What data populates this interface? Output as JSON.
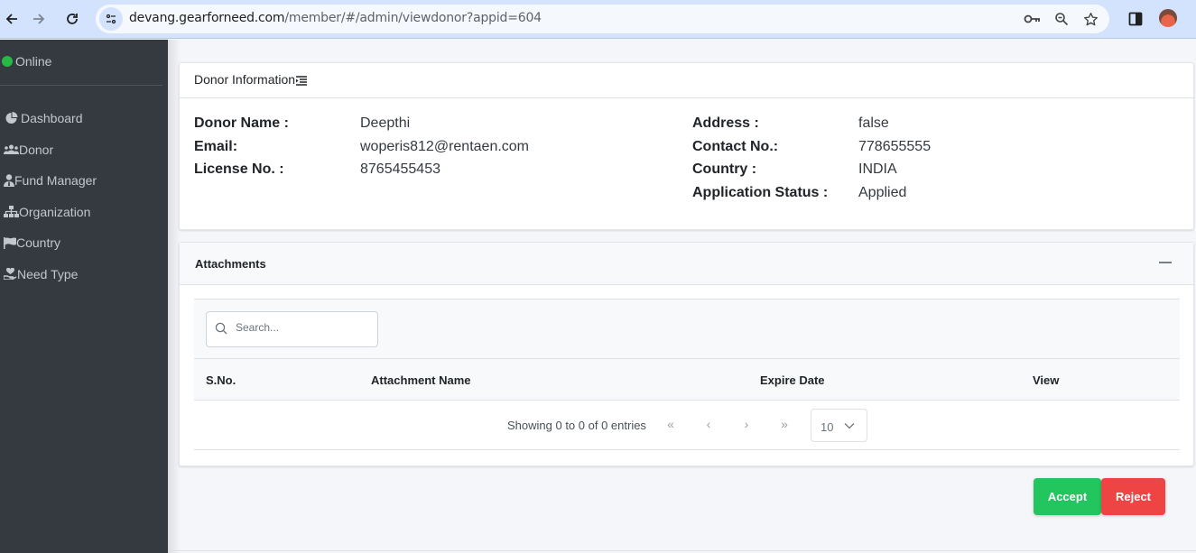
{
  "browser": {
    "url_domain": "devang.gearforneed.com",
    "url_path": "/member/#/admin/viewdonor?appid=604",
    "icons": [
      "back-icon",
      "forward-icon",
      "reload-icon",
      "site-info-icon",
      "password-key-icon",
      "zoom-icon",
      "bookmark-star-icon",
      "side-panel-icon",
      "profile-avatar"
    ]
  },
  "sidebar": {
    "status": "Online",
    "status_color": "#28b845",
    "items": [
      {
        "label": "Dashboard",
        "icon": "pie-chart-icon"
      },
      {
        "label": "Donor",
        "icon": "users-icon"
      },
      {
        "label": "Fund Manager",
        "icon": "user-tie-icon"
      },
      {
        "label": "Organization",
        "icon": "sitemap-icon"
      },
      {
        "label": "Country",
        "icon": "flag-icon"
      },
      {
        "label": "Need Type",
        "icon": "hand-heart-icon"
      }
    ]
  },
  "donor_info": {
    "title": "Donor Information",
    "left": [
      {
        "label": "Donor Name :",
        "value": "Deepthi"
      },
      {
        "label": "Email:",
        "value": "woperis812@rentaen.com"
      },
      {
        "label": "License No. :",
        "value": "8765455453"
      }
    ],
    "right": [
      {
        "label": "Address :",
        "value": "false"
      },
      {
        "label": "Contact No.:",
        "value": "778655555"
      },
      {
        "label": "Country :",
        "value": "INDIA"
      },
      {
        "label": "Application Status :",
        "value": "Applied"
      }
    ]
  },
  "attachments": {
    "title": "Attachments",
    "search_placeholder": "Search...",
    "columns": [
      "S.No.",
      "Attachment Name",
      "Expire Date",
      "View"
    ],
    "rows": [],
    "showing": "Showing 0 to 0 of 0 entries",
    "pager": {
      "first": "«",
      "prev": "‹",
      "next": "›",
      "last": "»"
    },
    "page_size": "10"
  },
  "actions": {
    "accept": "Accept",
    "reject": "Reject",
    "accept_color": "#22c55e",
    "reject_color": "#ef4444"
  }
}
